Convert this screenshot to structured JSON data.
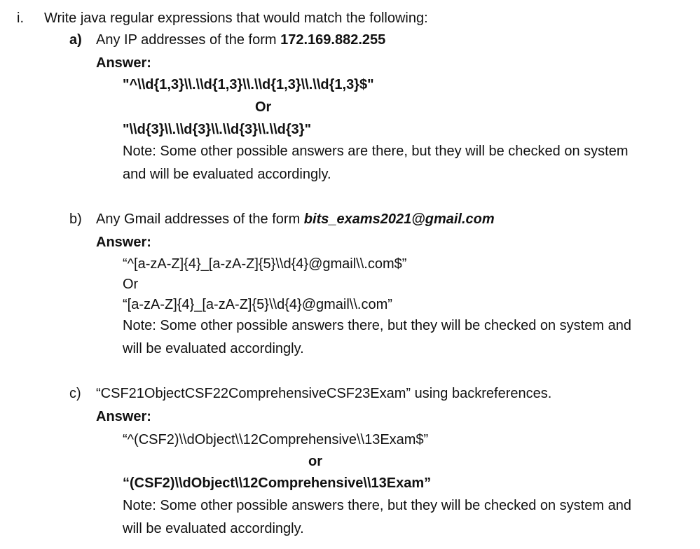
{
  "question": {
    "number": "i.",
    "text": "Write java regular expressions that would match the following:"
  },
  "part_a": {
    "label": "a)",
    "text_prefix": "Any IP addresses of the form ",
    "example": "172.169.882.255",
    "answer_label": "Answer:",
    "regex1": "\"^\\\\d{1,3}\\\\.\\\\d{1,3}\\\\.\\\\d{1,3}\\\\.\\\\d{1,3}$\"",
    "or": "Or",
    "regex2": "\"\\\\d{3}\\\\.\\\\d{3}\\\\.\\\\d{3}\\\\.\\\\d{3}\"",
    "note_line1": "Note: Some other possible answers are there, but they will be checked on system",
    "note_line2": "and will be evaluated accordingly."
  },
  "part_b": {
    "label": "b)",
    "text_prefix": "Any Gmail addresses of the form ",
    "example": "bits_exams2021@gmail.com",
    "answer_label": "Answer:",
    "regex1": "“^[a-zA-Z]{4}_[a-zA-Z]{5}\\\\d{4}@gmail\\\\.com$”",
    "or": "Or",
    "regex2": "“[a-zA-Z]{4}_[a-zA-Z]{5}\\\\d{4}@gmail\\\\.com”",
    "note_line1": "Note: Some other possible answers there, but they will be checked on system and",
    "note_line2": "will be evaluated accordingly."
  },
  "part_c": {
    "label": "c)",
    "text": "“CSF21ObjectCSF22ComprehensiveCSF23Exam” using backreferences.",
    "answer_label": "Answer:",
    "regex1": "“^(CSF2)\\\\dObject\\\\12Comprehensive\\\\13Exam$”",
    "or": "or",
    "regex2": "“(CSF2)\\\\dObject\\\\12Comprehensive\\\\13Exam”",
    "note_line1": "Note: Some other possible answers there, but they will be checked on system and",
    "note_line2": "will be evaluated accordingly."
  }
}
